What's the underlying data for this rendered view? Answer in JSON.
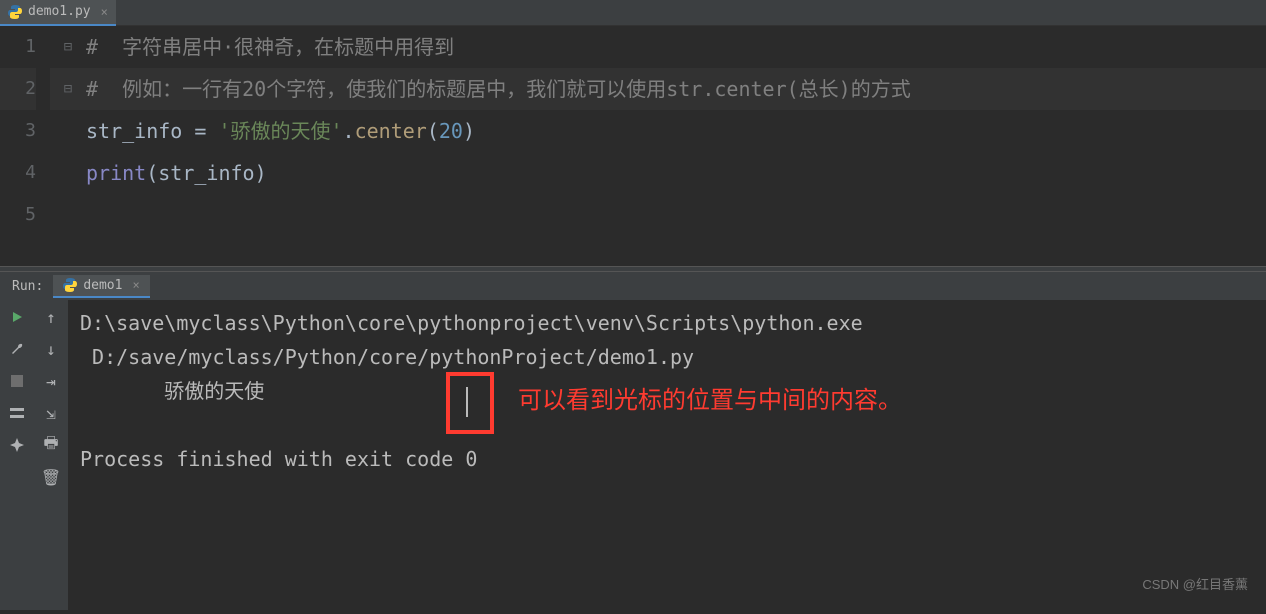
{
  "tab": {
    "filename": "demo1.py"
  },
  "gutter": [
    "1",
    "2",
    "3",
    "4",
    "5"
  ],
  "code": {
    "comment1_hash": "#  ",
    "comment1_text": "字符串居中·很神奇，在标题中用得到",
    "comment2_hash": "#  ",
    "comment2_text": "例如：一行有20个字符，使我们的标题居中，我们就可以使用str.center(总长)的方式",
    "comment2_num": "20",
    "line3_var": "str_info",
    "line3_eq": " = ",
    "line3_str": "'骄傲的天使'",
    "line3_dot": ".",
    "line3_fn": "center",
    "line3_paren_o": "(",
    "line3_arg": "20",
    "line3_paren_c": ")",
    "line4_fn": "print",
    "line4_paren_o": "(",
    "line4_arg": "str_info",
    "line4_paren_c": ")"
  },
  "run": {
    "label": "Run:",
    "tabname": "demo1"
  },
  "console": {
    "line1": "D:\\save\\myclass\\Python\\core\\pythonproject\\venv\\Scripts\\python.exe",
    "line2": " D:/save/myclass/Python/core/pythonProject/demo1.py",
    "output": "       骄傲的天使       ",
    "exit": "Process finished with exit code 0"
  },
  "annotation": "可以看到光标的位置与中间的内容。",
  "watermark": "CSDN @红目香薰"
}
